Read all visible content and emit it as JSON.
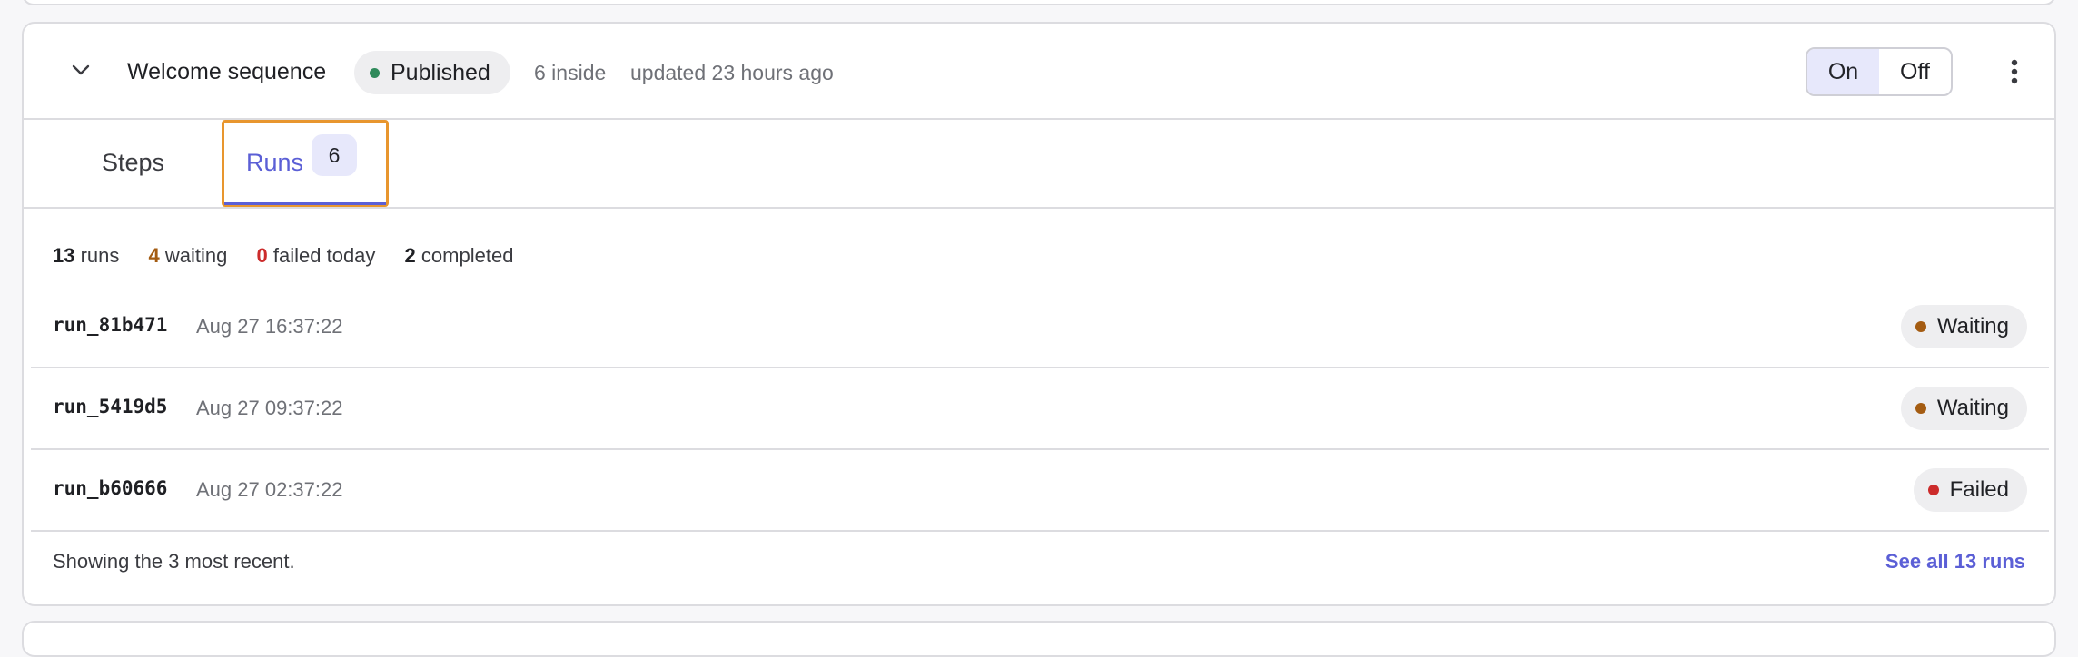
{
  "sequence": {
    "title": "Welcome sequence",
    "status": "Published",
    "status_color": "#2f8a5b",
    "inside_count": "6 inside",
    "updated": "updated 23 hours ago",
    "toggle": {
      "on_label": "On",
      "off_label": "Off",
      "selected": "On"
    },
    "icons": {
      "collapse": "chevron-down-icon",
      "menu": "kebab-icon"
    }
  },
  "tabs": [
    {
      "label": "Steps",
      "active": false
    },
    {
      "label": "Runs",
      "badge": "6",
      "active": true
    }
  ],
  "accent_color": "#5b5fd6",
  "stats": {
    "runs": {
      "count": "13",
      "label": "runs"
    },
    "waiting": {
      "count": "4",
      "label": "waiting",
      "color": "#a45c12"
    },
    "failed": {
      "count": "0",
      "label": "failed today",
      "color": "#cc2b2b"
    },
    "completed": {
      "count": "2",
      "label": "completed"
    }
  },
  "runs": [
    {
      "id": "run_81b471",
      "time": "Aug 27 16:37:22",
      "status": "Waiting",
      "status_color": "#a45c12"
    },
    {
      "id": "run_5419d5",
      "time": "Aug 27 09:37:22",
      "status": "Waiting",
      "status_color": "#a45c12"
    },
    {
      "id": "run_b60666",
      "time": "Aug 27 02:37:22",
      "status": "Failed",
      "status_color": "#cc2b2b"
    }
  ],
  "footer": {
    "note": "Showing the 3 most recent.",
    "see_all": "See all 13 runs"
  }
}
